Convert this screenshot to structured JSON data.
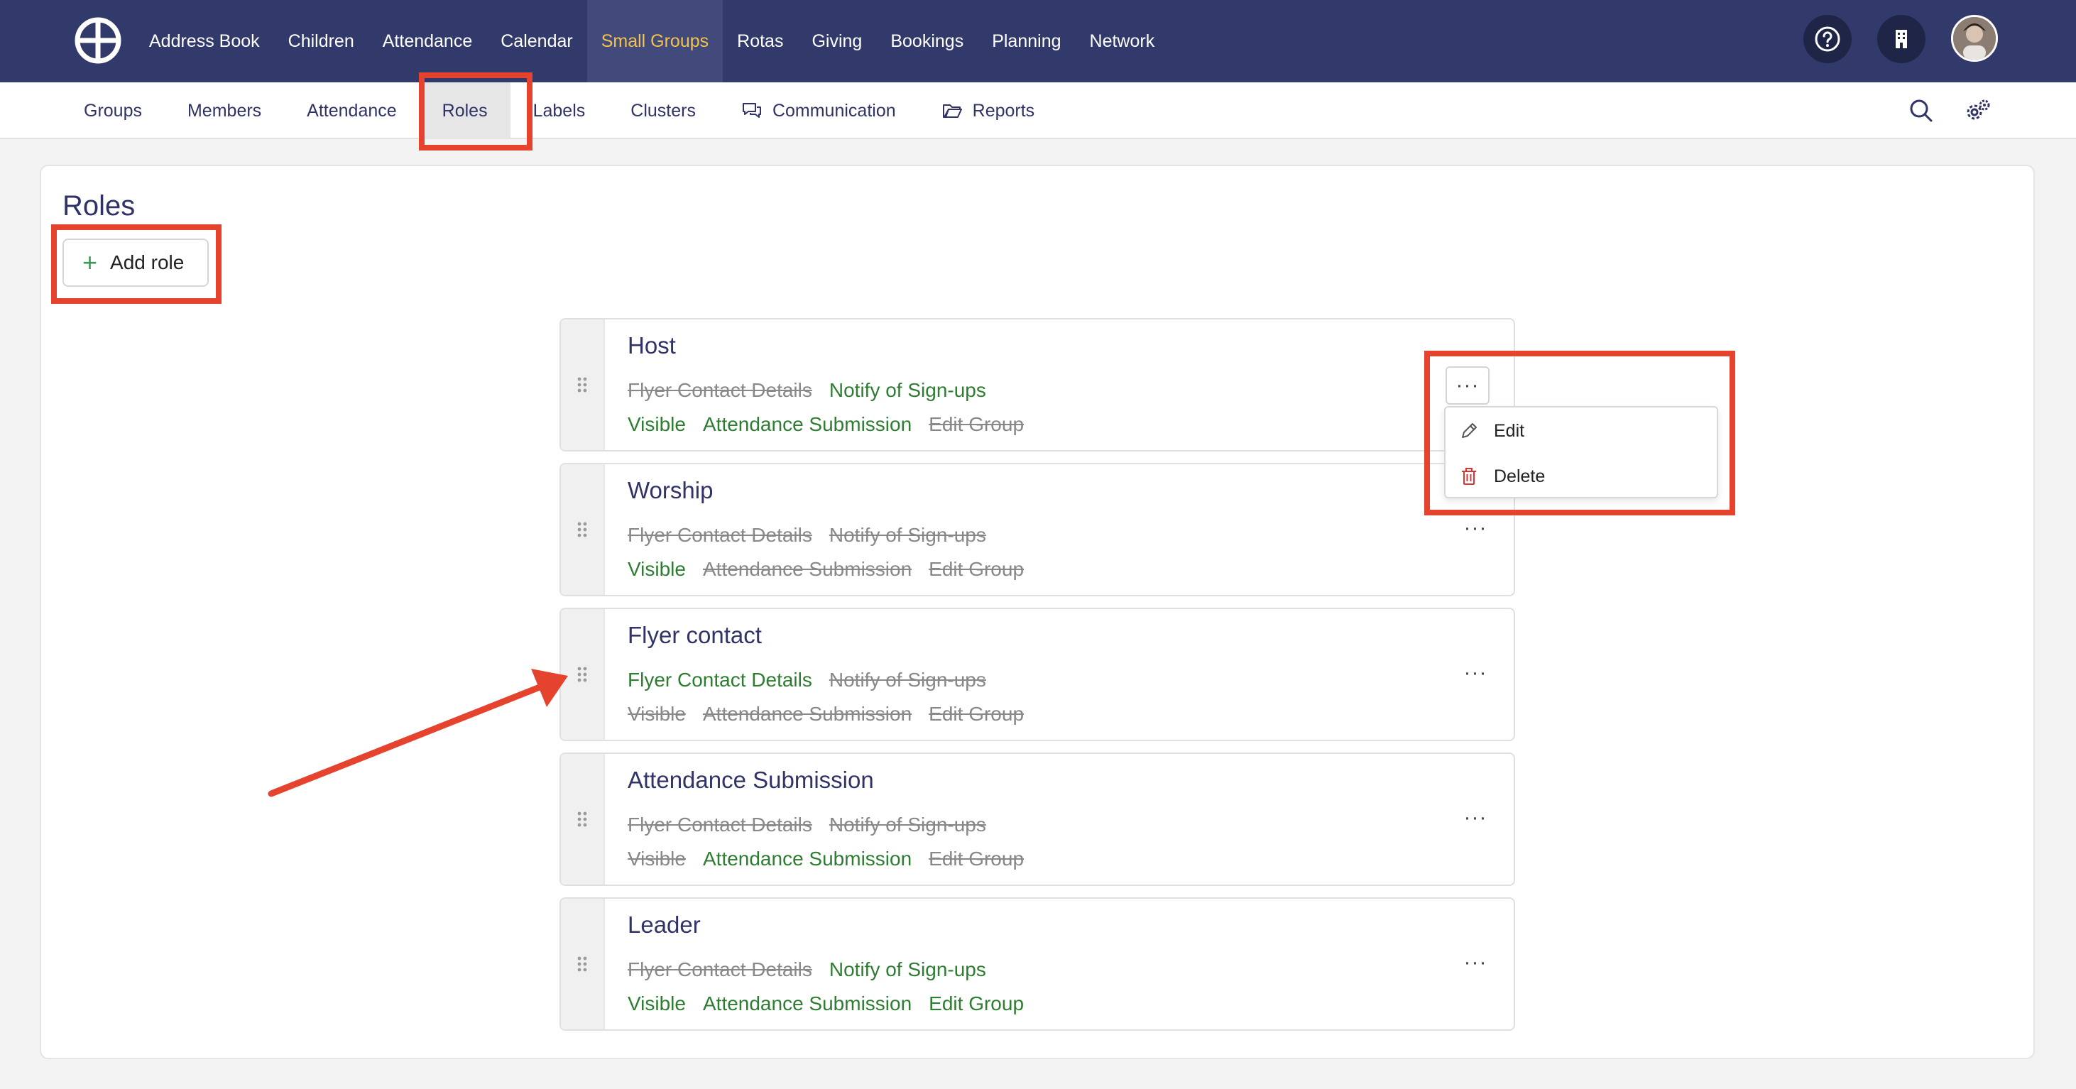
{
  "topnav": {
    "items": [
      "Address Book",
      "Children",
      "Attendance",
      "Calendar",
      "Small Groups",
      "Rotas",
      "Giving",
      "Bookings",
      "Planning",
      "Network"
    ],
    "active_index": 4
  },
  "subnav": {
    "items": [
      {
        "label": "Groups",
        "icon": ""
      },
      {
        "label": "Members",
        "icon": ""
      },
      {
        "label": "Attendance",
        "icon": ""
      },
      {
        "label": "Roles",
        "icon": ""
      },
      {
        "label": "Labels",
        "icon": ""
      },
      {
        "label": "Clusters",
        "icon": ""
      },
      {
        "label": "Communication",
        "icon": "chat-icon"
      },
      {
        "label": "Reports",
        "icon": "folder-icon"
      }
    ],
    "active_index": 3
  },
  "page": {
    "title": "Roles",
    "add_role_label": "Add role"
  },
  "roles": [
    {
      "name": "Host",
      "line1": [
        {
          "label": "Flyer Contact Details",
          "on": false
        },
        {
          "label": "Notify of Sign-ups",
          "on": true
        }
      ],
      "line2": [
        {
          "label": "Visible",
          "on": true
        },
        {
          "label": "Attendance Submission",
          "on": true
        },
        {
          "label": "Edit Group",
          "on": false
        }
      ]
    },
    {
      "name": "Worship",
      "line1": [
        {
          "label": "Flyer Contact Details",
          "on": false
        },
        {
          "label": "Notify of Sign-ups",
          "on": false
        }
      ],
      "line2": [
        {
          "label": "Visible",
          "on": true
        },
        {
          "label": "Attendance Submission",
          "on": false
        },
        {
          "label": "Edit Group",
          "on": false
        }
      ]
    },
    {
      "name": "Flyer contact",
      "line1": [
        {
          "label": "Flyer Contact Details",
          "on": true
        },
        {
          "label": "Notify of Sign-ups",
          "on": false
        }
      ],
      "line2": [
        {
          "label": "Visible",
          "on": false
        },
        {
          "label": "Attendance Submission",
          "on": false
        },
        {
          "label": "Edit Group",
          "on": false
        }
      ]
    },
    {
      "name": "Attendance Submission",
      "line1": [
        {
          "label": "Flyer Contact Details",
          "on": false
        },
        {
          "label": "Notify of Sign-ups",
          "on": false
        }
      ],
      "line2": [
        {
          "label": "Visible",
          "on": false
        },
        {
          "label": "Attendance Submission",
          "on": true
        },
        {
          "label": "Edit Group",
          "on": false
        }
      ]
    },
    {
      "name": "Leader",
      "line1": [
        {
          "label": "Flyer Contact Details",
          "on": false
        },
        {
          "label": "Notify of Sign-ups",
          "on": true
        }
      ],
      "line2": [
        {
          "label": "Visible",
          "on": true
        },
        {
          "label": "Attendance Submission",
          "on": true
        },
        {
          "label": "Edit Group",
          "on": true
        }
      ]
    }
  ],
  "row_menu": {
    "more_label": "···",
    "edit_label": "Edit",
    "delete_label": "Delete"
  },
  "colors": {
    "nav_bg": "#323a6c",
    "active_nav_text": "#f2c24b",
    "enabled_permission": "#2e7d32",
    "disabled_permission": "#888888",
    "annotation": "#e5432d"
  }
}
